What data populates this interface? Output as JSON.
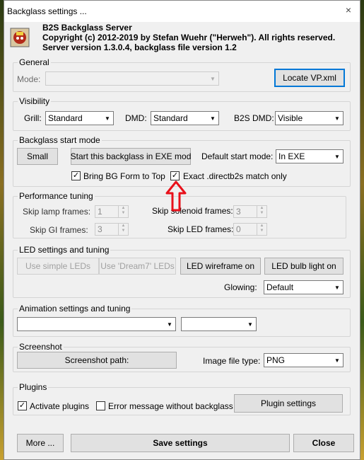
{
  "window": {
    "title": "Backglass settings ...",
    "close": "×"
  },
  "header": {
    "line1": "B2S Backglass Server",
    "line2": "Copyright (c) 2012-2019 by Stefan Wuehr (\"Herweh\"). All rights reserved.",
    "line3": "Server version 1.3.0.4, backglass file version 1.2"
  },
  "general": {
    "title": "General",
    "mode_label": "Mode:",
    "mode_value": "",
    "locate_button": "Locate VP.xml"
  },
  "visibility": {
    "title": "Visibility",
    "grill_label": "Grill:",
    "grill_value": "Standard",
    "dmd_label": "DMD:",
    "dmd_value": "Standard",
    "b2sdmd_label": "B2S DMD:",
    "b2sdmd_value": "Visible"
  },
  "startmode": {
    "title": "Backglass start mode",
    "small_button": "Small",
    "exe_button": "Start this backglass in EXE mod",
    "default_label": "Default start mode:",
    "default_value": "In EXE",
    "bring_label": "Bring BG Form to Top",
    "exact_label": "Exact .directb2s match only"
  },
  "performance": {
    "title": "Performance tuning",
    "lamp_label": "Skip lamp frames:",
    "lamp_value": "1",
    "solenoid_label": "Skip solenoid frames:",
    "solenoid_value": "3",
    "gi_label": "Skip GI frames:",
    "gi_value": "3",
    "led_label": "Skip LED frames:",
    "led_value": "0"
  },
  "led": {
    "title": "LED settings and tuning",
    "simple_button": "Use simple LEDs",
    "dream7_button": "Use 'Dream7' LEDs",
    "wireframe_button": "LED wireframe on",
    "bulb_button": "LED bulb light on",
    "glowing_label": "Glowing:",
    "glowing_value": "Default"
  },
  "animation": {
    "title": "Animation settings and tuning",
    "combo1_value": "",
    "combo2_value": ""
  },
  "screenshot": {
    "title": "Screenshot",
    "path_button": "Screenshot path:",
    "type_label": "Image file type:",
    "type_value": "PNG"
  },
  "plugins": {
    "title": "Plugins",
    "activate_label": "Activate plugins",
    "error_label": "Error message without backglass",
    "settings_button": "Plugin settings"
  },
  "footer": {
    "more_button": "More ...",
    "save_button": "Save settings",
    "close_button": "Close"
  },
  "colors": {
    "arrow": "#e8101a",
    "accent": "#0078d7"
  }
}
